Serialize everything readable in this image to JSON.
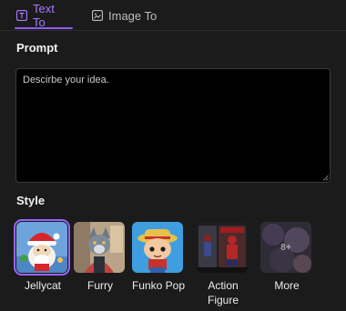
{
  "tabs": [
    {
      "label": "Text To",
      "icon": "text-icon",
      "active": true
    },
    {
      "label": "Image To",
      "icon": "image-icon",
      "active": false
    }
  ],
  "prompt": {
    "label": "Prompt",
    "placeholder": "Descirbe your idea.",
    "value": ""
  },
  "style": {
    "label": "Style",
    "items": [
      {
        "name": "Jellycat",
        "selected": true
      },
      {
        "name": "Furry",
        "selected": false
      },
      {
        "name": "Funko Pop",
        "selected": false
      },
      {
        "name": "Action Figure",
        "selected": false
      },
      {
        "name": "More",
        "selected": false,
        "overlay_text": "8+"
      }
    ]
  },
  "colors": {
    "background": "#1b1b1b",
    "accent": "#8f5bff",
    "input_bg": "#000000"
  }
}
